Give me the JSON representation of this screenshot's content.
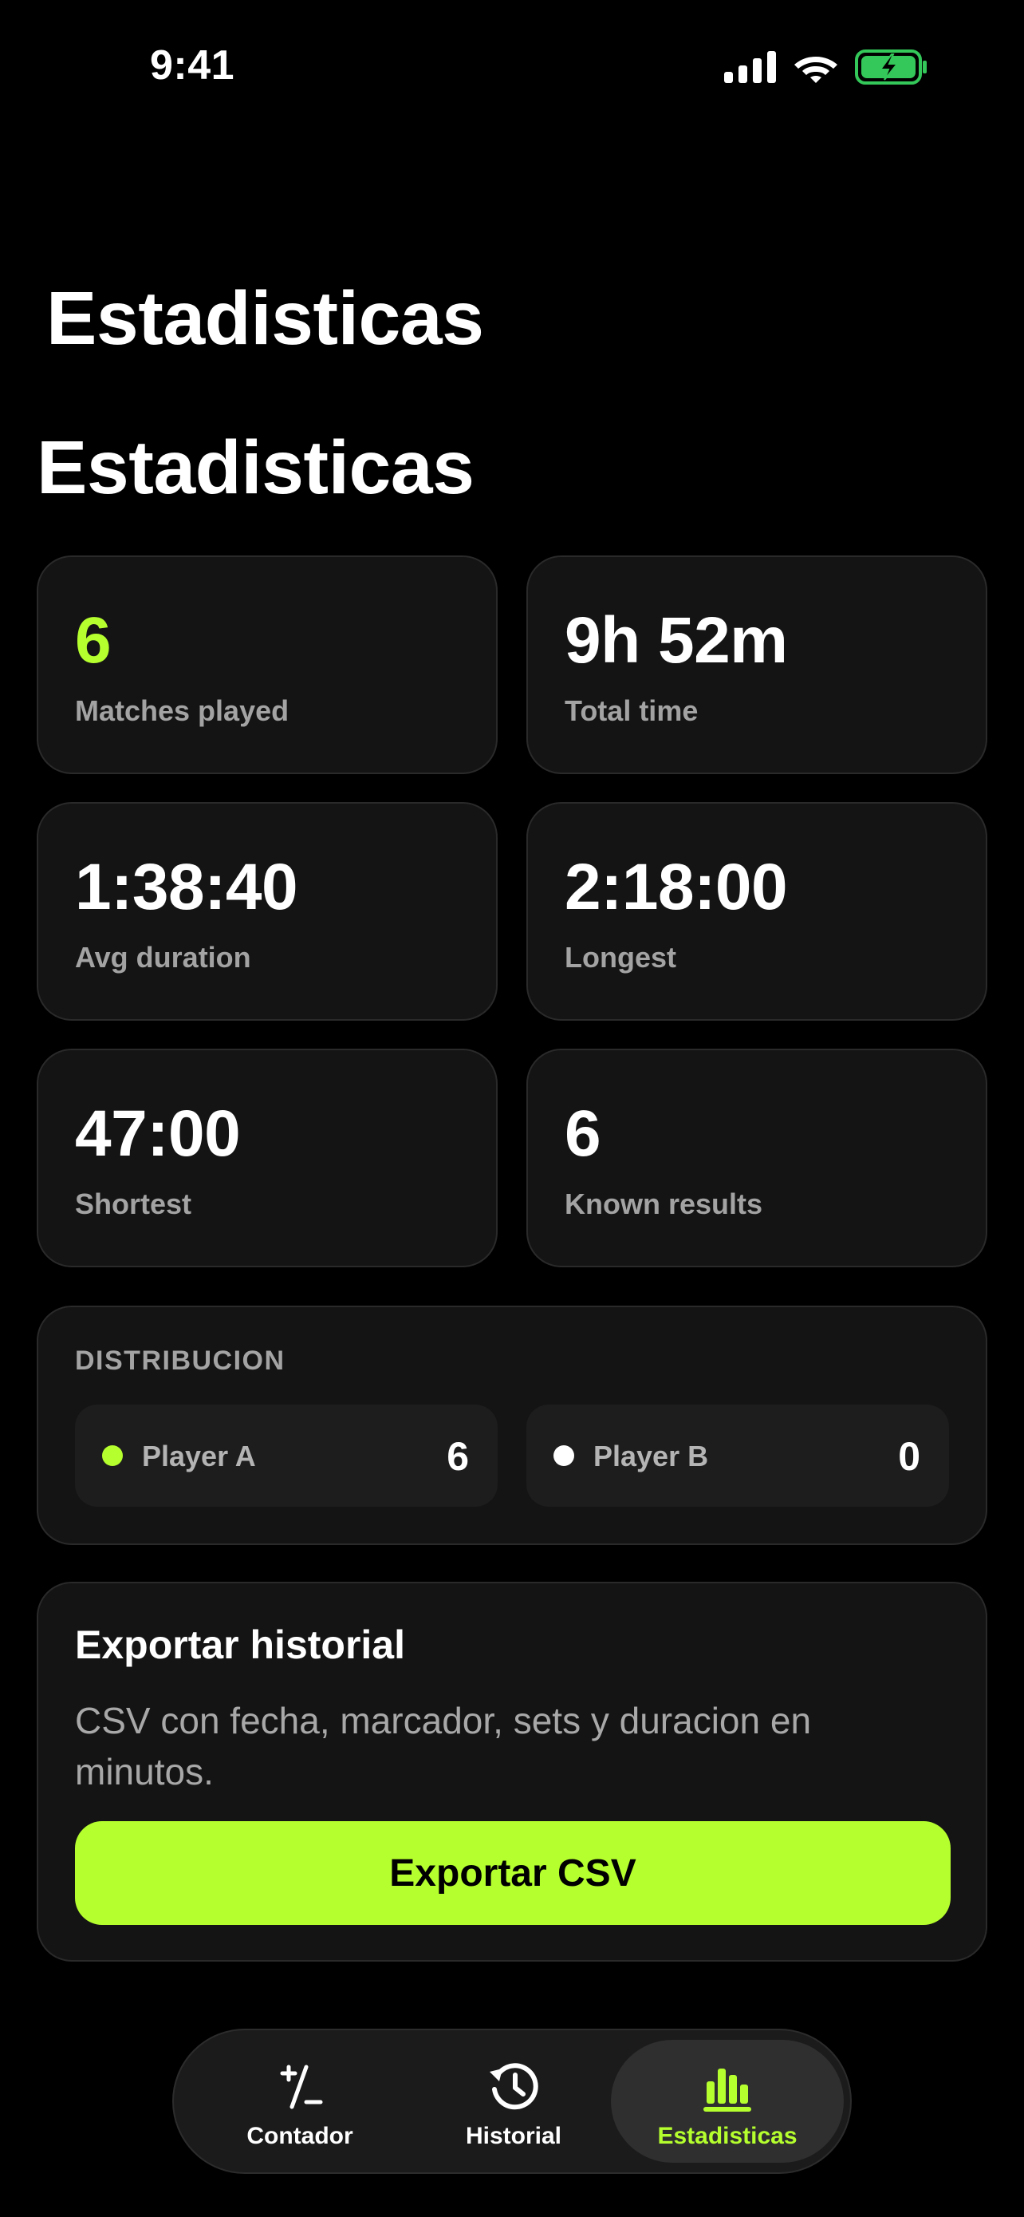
{
  "status_bar": {
    "time": "9:41"
  },
  "nav_title": "Estadisticas",
  "section_title": "Estadisticas",
  "stats": [
    {
      "value": "6",
      "label": "Matches played",
      "accent": true
    },
    {
      "value": "9h 52m",
      "label": "Total time",
      "accent": false
    },
    {
      "value": "1:38:40",
      "label": "Avg duration",
      "accent": false
    },
    {
      "value": "2:18:00",
      "label": "Longest",
      "accent": false
    },
    {
      "value": "47:00",
      "label": "Shortest",
      "accent": false
    },
    {
      "value": "6",
      "label": "Known results",
      "accent": false
    }
  ],
  "distribution": {
    "heading": "DISTRIBUCION",
    "players": [
      {
        "name": "Player A",
        "count": "6",
        "dot_color": "#b5ff2e"
      },
      {
        "name": "Player B",
        "count": "0",
        "dot_color": "#ffffff"
      }
    ]
  },
  "export": {
    "title": "Exportar historial",
    "description": "CSV con fecha, marcador, sets y duracion en minutos.",
    "button_label": "Exportar CSV"
  },
  "tab_bar": {
    "tabs": [
      {
        "label": "Contador",
        "icon": "plus-minus-icon",
        "active": false
      },
      {
        "label": "Historial",
        "icon": "history-clock-icon",
        "active": false
      },
      {
        "label": "Estadisticas",
        "icon": "bar-chart-icon",
        "active": true
      }
    ]
  },
  "colors": {
    "accent": "#b5ff2e",
    "background": "#000000",
    "card": "#141414",
    "battery": "#34c759"
  }
}
